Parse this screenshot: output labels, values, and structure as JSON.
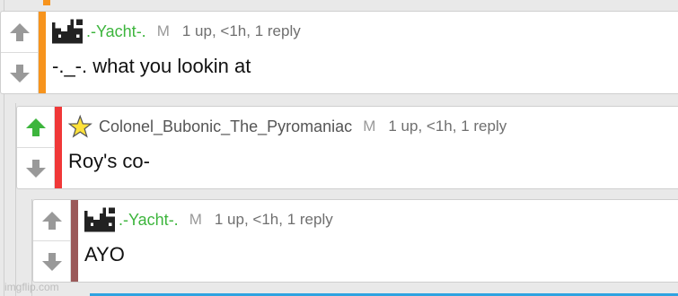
{
  "colors": {
    "background": "#e9e9e9",
    "username_green": "#3db53d",
    "upvote_active": "#3db53d",
    "vote_inactive": "#999999",
    "bar_orange": "#f7941d",
    "bar_red": "#f03838",
    "bar_brown": "#9b5a5a",
    "bottom_edge_blue": "#2fa3e0",
    "star_yellow": "#ffe23a"
  },
  "comments": [
    {
      "username": ".-Yacht-.",
      "gender": "M",
      "upvotes": "1 up",
      "age": "<1h",
      "replies": "1 reply",
      "text": "-._-. what you lookin at",
      "avatar_icon": "pixel-avatar-icon",
      "upvoted": false
    },
    {
      "username": "Colonel_Bubonic_The_Pyromaniac",
      "gender": "M",
      "upvotes": "1 up",
      "age": "<1h",
      "replies": "1 reply",
      "text": "Roy's co-",
      "avatar_icon": "star-icon",
      "upvoted": true
    },
    {
      "username": ".-Yacht-.",
      "gender": "M",
      "upvotes": "1 up",
      "age": "<1h",
      "replies": "1 reply",
      "text": "AYO",
      "avatar_icon": "pixel-avatar-icon",
      "upvoted": false
    }
  ],
  "watermark": "imgflip.com"
}
